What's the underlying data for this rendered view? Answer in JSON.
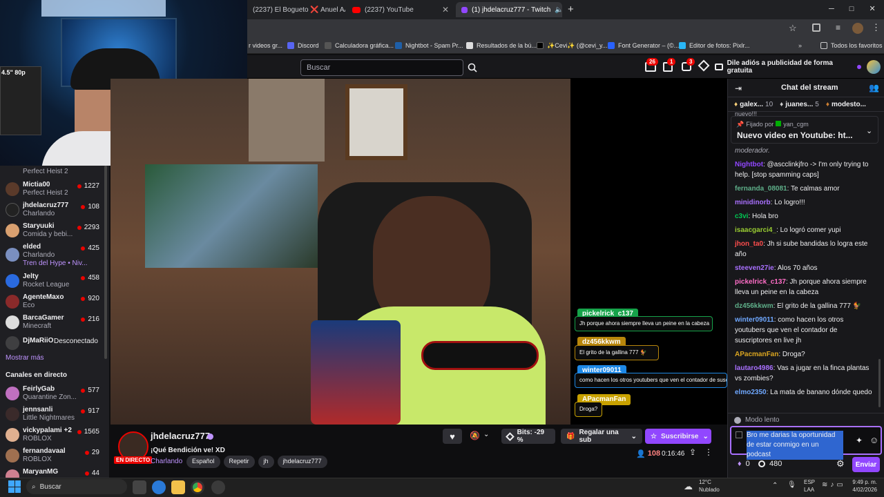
{
  "browser": {
    "tabs": [
      {
        "label": "(2237) El Bogueto ❌ Anuel AA",
        "active": false
      },
      {
        "label": "(2237) YouTube",
        "active": false
      },
      {
        "label": "(1) jhdelacruz777 - Twitch",
        "active": true
      }
    ],
    "new_tab_label": "+",
    "bookmarks": [
      "r videos gr...",
      "Discord",
      "Calculadora gráfica...",
      "Nightbot - Spam Pr...",
      "Resultados de la bú...",
      "✨Cevi✨ (@cevi_y...",
      "Font Generator – (©...",
      "Editor de fotos: Pixlr...",
      "Todos los favoritos"
    ]
  },
  "twitch_header": {
    "search_placeholder": "Buscar",
    "badge_counts": [
      "26",
      "1",
      "3"
    ],
    "ad_label": "Dile adiós a publicidad de forma gratuita"
  },
  "sidebar": {
    "channels": [
      {
        "name": "",
        "game": "Perfect Heist 2",
        "viewers": ""
      },
      {
        "name": "Mictia00",
        "game": "Perfect Heist 2",
        "viewers": "1227"
      },
      {
        "name": "jhdelacruz777",
        "game": "Charlando",
        "viewers": "108"
      },
      {
        "name": "Staryuuki",
        "game": "Comida y bebi...",
        "viewers": "2293"
      },
      {
        "name": "elded",
        "game": "Charlando",
        "viewers": "425"
      },
      {
        "name": "",
        "game": "Tren del Hype • Niv...",
        "viewers": ""
      },
      {
        "name": "Jelty",
        "game": "Rocket League",
        "viewers": "458"
      },
      {
        "name": "AgenteMaxo",
        "game": "Eco",
        "viewers": "920"
      },
      {
        "name": "BarcaGamer",
        "game": "Minecraft",
        "viewers": "216"
      },
      {
        "name": "DjMaRiiO",
        "game": "Desconectado",
        "viewers": ""
      }
    ],
    "show_more": "Mostrar más",
    "live_heading": "Canales en directo",
    "live_channels": [
      {
        "name": "FeirlyGab",
        "game": "Quarantine Zon...",
        "viewers": "577"
      },
      {
        "name": "jennsanli",
        "game": "Little Nightmares",
        "viewers": "917"
      },
      {
        "name": "vickypalami +2",
        "game": "ROBLOX",
        "viewers": "1565"
      },
      {
        "name": "fernandavaal",
        "game": "ROBLOX",
        "viewers": "29"
      },
      {
        "name": "MaryanMG",
        "game": "",
        "viewers": "44"
      }
    ]
  },
  "video": {
    "overlay_messages": [
      {
        "user": "pickelrick_c137",
        "text": "Jh porque ahora siempre lleva un peine en la cabeza",
        "color": "#16a34a"
      },
      {
        "user": "dz456kkwm",
        "text": "El grito de la gallina 777 🐓",
        "color": "#b8860b"
      },
      {
        "user": "winter09011",
        "text": "como hacen los otros youtubers que ven el contador de susc",
        "color": "#1e88e5"
      },
      {
        "user": "APacmanFan",
        "text": "Droga?",
        "color": "#c8a100"
      }
    ]
  },
  "stream_info": {
    "channel": "jhdelacruz777",
    "title": "¡Qué Bendición ve! XD",
    "category": "Charlando",
    "live_badge": "EN DIRECTO",
    "tags": [
      "Español",
      "Repetir",
      "jh",
      "jhdelacruz777"
    ],
    "bits_label": "Bits: -29 %",
    "gift_label": "Regalar una sub",
    "subscribe_label": "Suscribirse",
    "viewers": "108",
    "uptime": "0:16:46"
  },
  "chat": {
    "title": "Chat del stream",
    "top_gifters": [
      {
        "name": "galex...",
        "count": "10"
      },
      {
        "name": "juanes...",
        "count": "5"
      },
      {
        "name": "modesto...",
        "count": ""
      }
    ],
    "pinned_above": "nuevo!!!",
    "pinned_by_label": "Fijado por",
    "pinned_by_user": "yan_cgm",
    "pinned_message": "Nuevo video en Youtube: ht...",
    "partial_line": "moderador.",
    "messages": [
      {
        "user": "Nightbot",
        "text": "@ascclinkjfro -> I'm only trying to help. [stop spamming caps]",
        "color": "#9147ff"
      },
      {
        "user": "fernanda_08081",
        "text": "Te calmas amor",
        "color": "#5fb08a"
      },
      {
        "user": "minidinorb",
        "text": "Lo logro!!!",
        "color": "#a970ff"
      },
      {
        "user": "c3vi",
        "text": "Hola bro",
        "color": "#00c853"
      },
      {
        "user": "isaacgarci4_",
        "text": "Lo logró comer yupi",
        "color": "#9acd32"
      },
      {
        "user": "jhon_ta0",
        "text": "Jh si sube bandidas lo logra este año",
        "color": "#ff4d4d"
      },
      {
        "user": "steeven27ie",
        "text": "Alos 70 años",
        "color": "#a970ff"
      },
      {
        "user": "pickelrick_c137",
        "text": "Jh porque ahora siempre lleva un peine en la cabeza",
        "color": "#ff6ec7"
      },
      {
        "user": "dz456kkwm",
        "text": "El grito de la gallina 777 🐓",
        "color": "#5fb08a"
      },
      {
        "user": "winter09011",
        "text": "como hacen los otros youtubers que ven el contador de suscriptores en live jh",
        "color": "#6fa8ff"
      },
      {
        "user": "APacmanFan",
        "text": "Droga?",
        "color": "#daa520"
      },
      {
        "user": "lautaro4986",
        "text": "Vas a jugar en la finca plantas vs zombies?",
        "color": "#a970ff"
      },
      {
        "user": "elmo2350",
        "text": "La mata de banano dónde quedo",
        "color": "#6fa8ff"
      }
    ],
    "slow_mode_label": "Modo lento",
    "input_text": "Bro me darias la oportunidad de estar conmigo en un podcast",
    "bits_count": "0",
    "points_count": "480",
    "send_label": "Enviar"
  },
  "taskbar": {
    "search_label": "Buscar",
    "weather_temp": "12°C",
    "weather_desc": "Nublado",
    "lang_line1": "ESP",
    "lang_line2": "LAA",
    "time": "9:49 p. m.",
    "date": "4/02/2026"
  }
}
